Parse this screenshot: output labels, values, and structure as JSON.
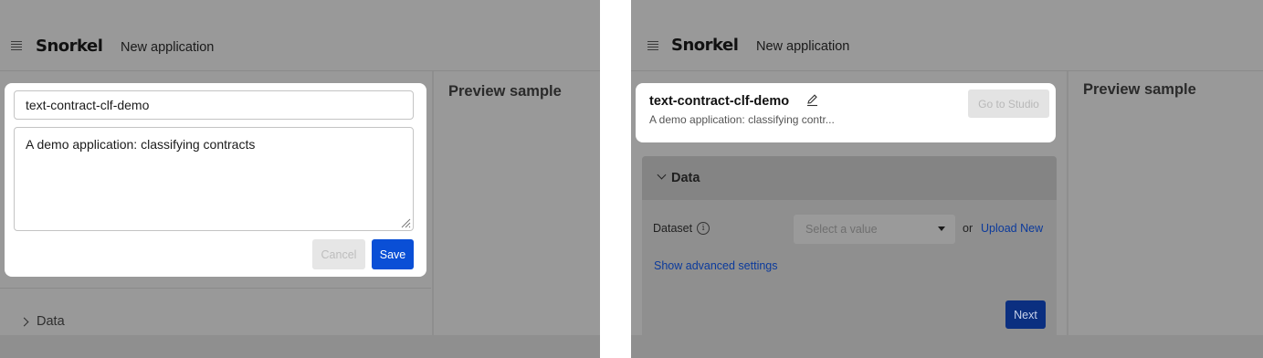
{
  "header": {
    "logo_text": "Snorkel",
    "title": "New application"
  },
  "left": {
    "name_value": "text-contract-clf-demo",
    "description_value": "A demo application: classifying contracts",
    "cancel_label": "Cancel",
    "save_label": "Save",
    "preview_title": "Preview sample",
    "data_section_label": "Data"
  },
  "right": {
    "app_name": "text-contract-clf-demo",
    "app_description": "A demo application: classifying contr...",
    "go_to_studio_label": "Go to Studio",
    "preview_title": "Preview sample",
    "data_section_label": "Data",
    "dataset_label": "Dataset",
    "info_glyph": "i",
    "dataset_select_placeholder": "Select a value",
    "or_text": "or",
    "upload_new_label": "Upload New",
    "advanced_settings_label": "Show advanced settings",
    "next_label": "Next"
  },
  "colors": {
    "overlay_gray": "#999999",
    "primary_blue": "#0a4fd6",
    "link_blue": "#0b3a9c"
  }
}
